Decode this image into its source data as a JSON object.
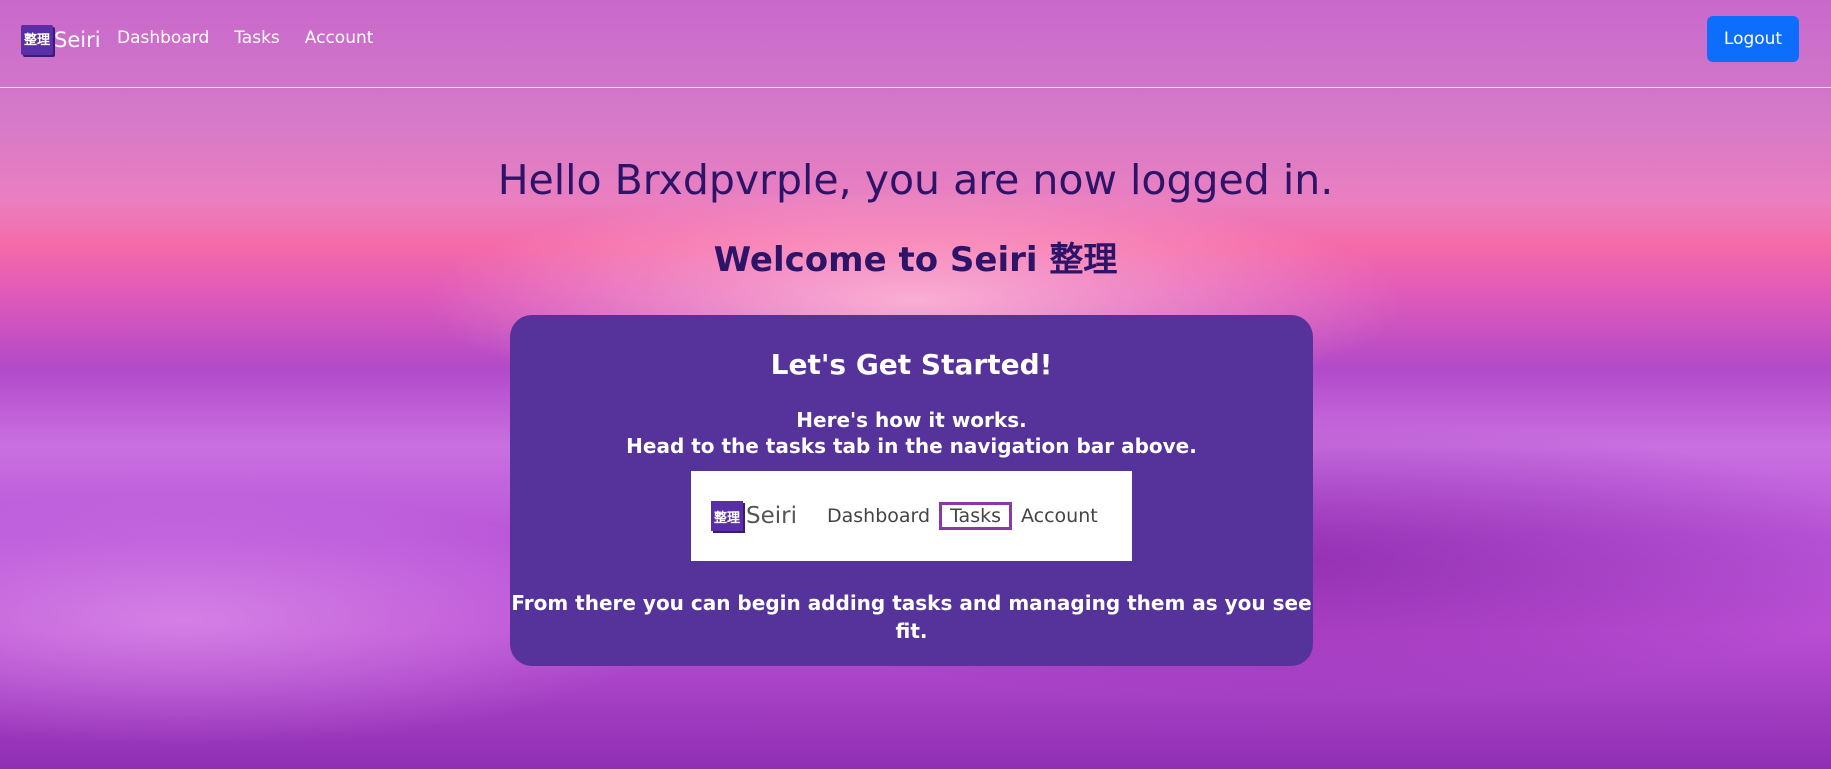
{
  "brand": {
    "logo_glyph": "整理",
    "name": "Seiri"
  },
  "nav": {
    "links": [
      "Dashboard",
      "Tasks",
      "Account"
    ],
    "logout_label": "Logout"
  },
  "hero": {
    "title": "Hello Brxdpvrple, you are now logged in.",
    "subtitle": "Welcome to Seiri 整理"
  },
  "card": {
    "heading": "Let's Get Started!",
    "line1": "Here's how it works.",
    "line2": "Head to the tasks tab in the navigation bar above.",
    "preview": {
      "logo_glyph": "整理",
      "brand": "Seiri",
      "links": [
        "Dashboard",
        "Tasks",
        "Account"
      ]
    },
    "footer": "From there you can begin adding tasks and managing them as you see fit."
  },
  "colors": {
    "accent": "#0d6efd",
    "card_bg": "#55339a",
    "heading_text": "#2e1468",
    "highlight_border": "#8a3aa6"
  }
}
